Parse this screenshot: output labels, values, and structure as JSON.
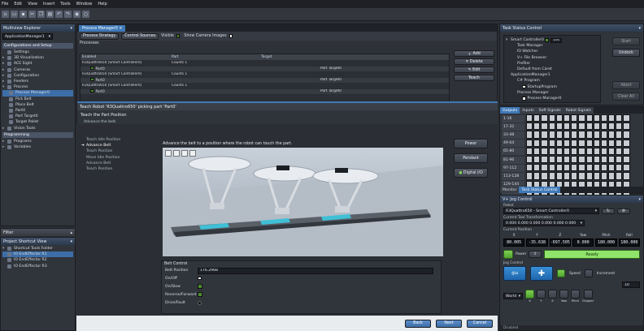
{
  "menu": [
    "File",
    "Edit",
    "View",
    "Insert",
    "Tools",
    "Window",
    "Help"
  ],
  "multiview": {
    "title": "Multiview Explorer",
    "device": "ApplicationManager1",
    "config_header": "Configurations and Setup",
    "config_items": [
      "Settings",
      "3D Visualization",
      "ACE Sight",
      "Cameras",
      "Configuration",
      "Feeders",
      "Process",
      "Process Manager0",
      "Pick Belt",
      "Place Belt",
      "Part0",
      "Part Target0",
      "Target Pallet",
      "Vision Tools"
    ],
    "programming_header": "Programming",
    "programming_items": [
      "Programs",
      "Variables"
    ]
  },
  "filter": {
    "label": "Filter"
  },
  "shortcut": {
    "title": "Project Shortcut View",
    "folder": "Shortcut Tools Folder",
    "items": [
      "IO EndEffector R1",
      "IO EndEffector R2",
      "IO EndEffector R3"
    ]
  },
  "pm": {
    "tab": "Process Manager0",
    "tabs": [
      "Process Strategy",
      "Control Sources"
    ],
    "visible_label": "Visible",
    "camera_label": "Show Camera Images",
    "processes_label": "Processes",
    "columns": [
      "Enabled",
      "Part",
      "Target"
    ],
    "rows": [
      {
        "robot": "R3Quattro650 [Smart Controller0]",
        "counts": "Counts 1",
        "part": "",
        "target": ""
      },
      {
        "robot": "Part0",
        "counts": "",
        "part": "",
        "target": "Part Target0"
      },
      {
        "robot": "R3Quattro650 [Smart Controller0]",
        "counts": "Counts 1",
        "part": "",
        "target": ""
      },
      {
        "robot": "Part0",
        "counts": "",
        "part": "",
        "target": "Part Target0"
      },
      {
        "robot": "R3Quattro650 [Smart Controller0]",
        "counts": "Counts 1",
        "part": "",
        "target": ""
      },
      {
        "robot": "Part0",
        "counts": "",
        "part": "",
        "target": "Part Target0"
      }
    ],
    "buttons": [
      "Add",
      "Delete",
      "Edit",
      "Teach"
    ]
  },
  "teach": {
    "title": "Teach Robot 'R3Quattro650' picking part 'Part0'",
    "heading": "Teach the Part Position",
    "sub": "Advance the belt.",
    "steps": [
      "Teach Idle Position",
      "Advance Belt",
      "Teach Position",
      "Move Idle Position",
      "Advance Belt",
      "Teach Position"
    ],
    "instruction": "Advance the belt to a position where the robot can touch the part.",
    "side_buttons": [
      "Power",
      "Pendant",
      "Digital I/O"
    ],
    "belt_control": "Belt Control",
    "belt_position_label": "Belt Position",
    "belt_position_value": "176.2968",
    "belt_rows": [
      "On/Off",
      "On/Slow",
      "Reverse/Forward",
      "Drive/Fault"
    ],
    "nav": [
      "Back",
      "Next",
      "Cancel"
    ]
  },
  "task": {
    "title": "Task Status Control",
    "controller": "Smart Controller0",
    "speed": "100",
    "items": [
      "Task Manager",
      "IO Watcher",
      "V+ File Browser",
      "Profiler",
      "Default from Caret",
      "ApplicationManager1",
      "C# Program",
      "StartupProgram",
      "Process Manager",
      "Process Manager0"
    ],
    "buttons": [
      "Start",
      "Undock",
      "Abort",
      "Clear All"
    ]
  },
  "io": {
    "tabs": [
      "Outputs",
      "Inputs",
      "Soft Signals",
      "Robot Signals"
    ],
    "ranges": [
      "1-16",
      "17-32",
      "33-48",
      "49-64",
      "65-80",
      "81-96",
      "97-112",
      "113-128",
      "129-144",
      "145-160"
    ],
    "bottom_tabs": [
      "Monitor",
      "Task Status Control"
    ]
  },
  "jog": {
    "title": "V+ Jog Control",
    "robot_label": "Robot",
    "robot": "R3Quattro650 - Smart Controller0",
    "tool_label": "Current Tool Transformation",
    "tool": "0.000 0.000 0.000 0.000 0.000 0.000",
    "pos_label": "Current Position",
    "axes": [
      "X",
      "Y",
      "Z",
      "Yaw",
      "Pitch",
      "Roll"
    ],
    "values": [
      "80.005",
      "-35.638",
      "-697.505",
      "0.000",
      "180.000",
      "180.000"
    ],
    "ready": "Ready",
    "power_label": "Power",
    "jog_label": "Jog Control",
    "speed_label": "Speed",
    "increment_label": "Increment",
    "speed_value": "10",
    "mode": "World",
    "jog_axes": [
      "X",
      "Y",
      "Z",
      "Yaw",
      "Pitch",
      "Gripper"
    ],
    "status": "Disabled"
  }
}
